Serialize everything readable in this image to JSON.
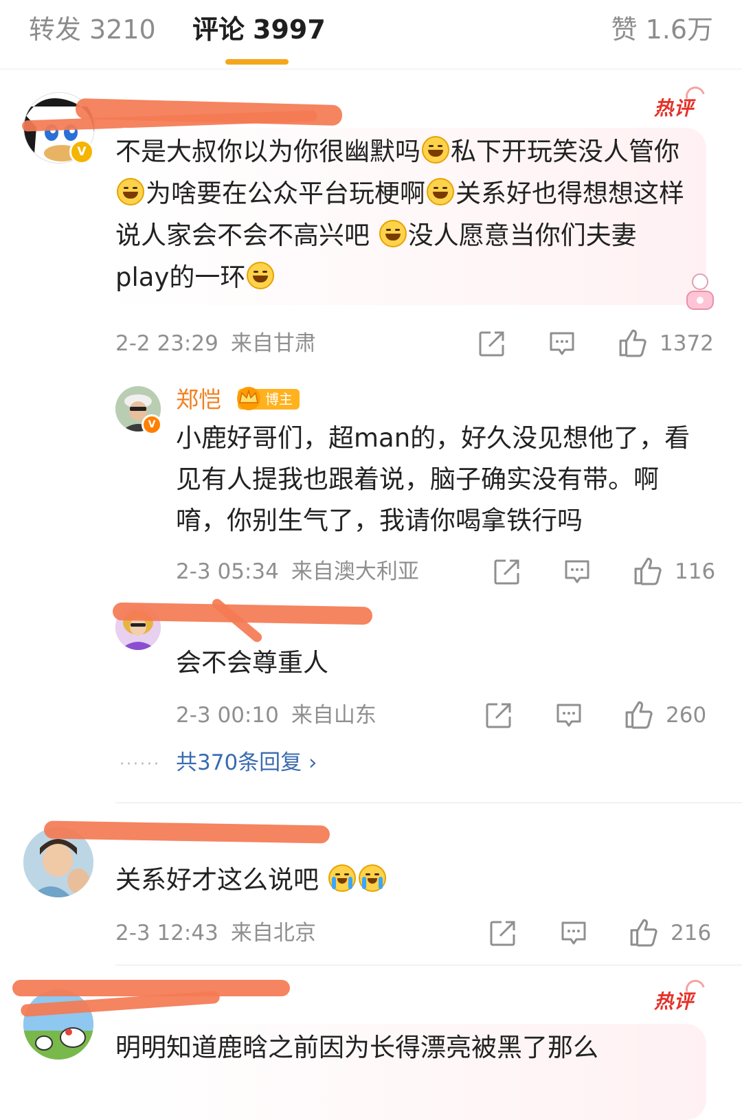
{
  "tabs": {
    "forward": {
      "label": "转发",
      "count": "3210"
    },
    "comments": {
      "label": "评论",
      "count": "3997"
    },
    "likes": {
      "label": "赞",
      "count": "1.6万"
    }
  },
  "colors": {
    "accent": "#f5a71c",
    "hot": "#e4322a",
    "link": "#3a6bb0",
    "name_highlight": "#f08020",
    "redaction": "#f47b54"
  },
  "hot_label": "热评",
  "comments": [
    {
      "hot": true,
      "text_parts": [
        "不是大叔你以为你很幽默吗",
        "私下开玩笑没人管你",
        "为啥要在公众平台玩梗啊",
        "关系好也得想想这样说人家会不会不高兴吧 ",
        "没人愿意当你们夫妻play的一环"
      ],
      "time": "2-2 23:29",
      "location": "来自甘肃",
      "likes": "1372",
      "replies": [
        {
          "name": "郑恺",
          "tag": "博主",
          "text": "小鹿好哥们，超man的，好久没见想他了，看见有人提我也跟着说，脑子确实没有带。啊唷，你别生气了，我请你喝拿铁行吗",
          "time": "2-3 05:34",
          "location": "来自澳大利亚",
          "likes": "116"
        },
        {
          "text": "会不会尊重人",
          "time": "2-3 00:10",
          "location": "来自山东",
          "likes": "260"
        }
      ],
      "more_replies": "共370条回复 ›"
    },
    {
      "hot": false,
      "text": "关系好才这么说吧 ",
      "time": "2-3 12:43",
      "location": "来自北京",
      "likes": "216"
    },
    {
      "hot": true,
      "text": "明明知道鹿晗之前因为长得漂亮被黑了那么"
    }
  ],
  "icons": [
    "share-icon",
    "reply-icon",
    "thumbs-up-icon",
    "chevron-right-icon",
    "crown-icon",
    "verified-badge-icon"
  ]
}
